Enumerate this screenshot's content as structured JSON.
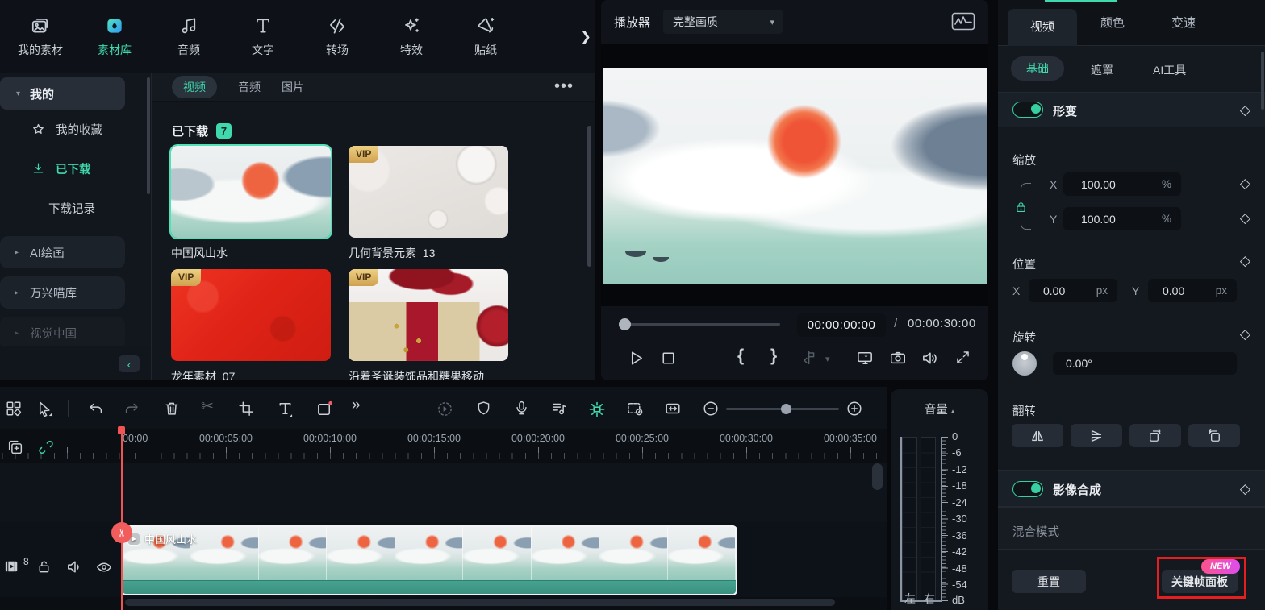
{
  "colors": {
    "accent": "#3fd9ad",
    "playhead": "#f25858",
    "vip_gold": "#d9a94e",
    "annotation_red": "#e51f1f"
  },
  "icons": {
    "chevron_right": "❯",
    "collapse_left": "‹",
    "caret_down": "▾",
    "caret_right": "▸",
    "caret_up": "▴",
    "ellipsis": "•••",
    "more_arrows": "»",
    "scissors": "✂",
    "diamond": "◇",
    "brace_in": "{",
    "brace_out": "}",
    "slash": "/",
    "play_small": "▶"
  },
  "top_nav": {
    "items": [
      {
        "label": "我的素材"
      },
      {
        "label": "素材库"
      },
      {
        "label": "音频"
      },
      {
        "label": "文字"
      },
      {
        "label": "转场"
      },
      {
        "label": "特效"
      },
      {
        "label": "贴纸"
      }
    ]
  },
  "sidebar": {
    "my": "我的",
    "favorites": "我的收藏",
    "downloaded": "已下载",
    "download_history": "下载记录",
    "groups": [
      {
        "label": "AI绘画"
      },
      {
        "label": "万兴喵库"
      },
      {
        "label": "视觉中国"
      }
    ]
  },
  "library": {
    "tabs": [
      {
        "label": "视频"
      },
      {
        "label": "音频"
      },
      {
        "label": "图片"
      }
    ],
    "section": "已下载",
    "count": "7",
    "vip": "VIP",
    "cards": [
      {
        "title": "中国风山水"
      },
      {
        "title": "几何背景元素_13"
      },
      {
        "title": "龙年素材_07"
      },
      {
        "title": "沿着圣诞装饰品和糖果移动"
      }
    ]
  },
  "player": {
    "label": "播放器",
    "quality": "完整画质",
    "time_current": "00:00:00:00",
    "time_separator": "/",
    "time_total": "00:00:30:00"
  },
  "inspector": {
    "tabs": [
      {
        "label": "视频"
      },
      {
        "label": "颜色"
      },
      {
        "label": "变速"
      }
    ],
    "subtabs": [
      {
        "label": "基础"
      },
      {
        "label": "遮罩"
      },
      {
        "label": "AI工具"
      }
    ],
    "transform": "形变",
    "scale": {
      "label": "缩放",
      "x": "X",
      "x_value": "100.00",
      "x_unit": "%",
      "y": "Y",
      "y_value": "100.00",
      "y_unit": "%"
    },
    "position": {
      "label": "位置",
      "x": "X",
      "x_value": "0.00",
      "x_unit": "px",
      "y": "Y",
      "y_value": "0.00",
      "y_unit": "px"
    },
    "rotate": {
      "label": "旋转",
      "value": "0.00°"
    },
    "flip": "翻转",
    "composite": "影像合成",
    "blend": "混合模式",
    "reset": "重置",
    "keyframe_panel": "关键帧面板",
    "new": "NEW"
  },
  "timeline": {
    "ruler": [
      "00:00",
      "00:00:05:00",
      "00:00:10:00",
      "00:00:15:00",
      "00:00:20:00",
      "00:00:25:00",
      "00:00:30:00",
      "00:00:35:00"
    ],
    "clip_title": "中国风山水",
    "track_badge": "8"
  },
  "volume": {
    "title": "音量",
    "ticks": [
      "0",
      "-6",
      "-12",
      "-18",
      "-24",
      "-30",
      "-36",
      "-42",
      "-48",
      "-54",
      "dB"
    ],
    "left": "左",
    "right": "右"
  }
}
